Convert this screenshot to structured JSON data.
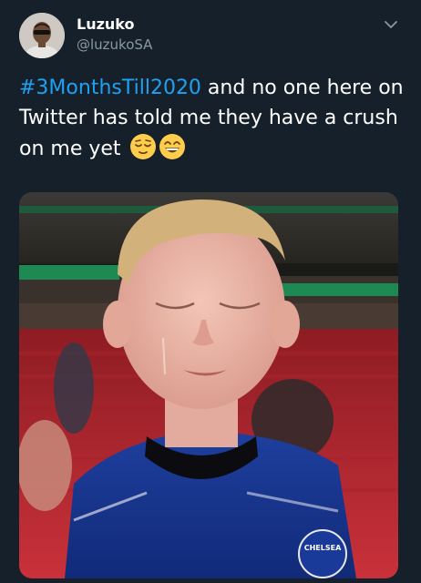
{
  "author": {
    "display_name": "Luzuko",
    "handle": "@luzukoSA"
  },
  "tweet": {
    "hashtag": "#3MonthsTill2020",
    "text_after_hashtag": " and no one here on Twitter has told me they have a crush on me yet",
    "emojis": [
      "relieved-face-emoji",
      "grinning-squinting-face-emoji"
    ]
  },
  "media": {
    "description_icon": "photo",
    "jersey_crest_text": "CHELSEA"
  },
  "colors": {
    "background": "#15202b",
    "text": "#ffffff",
    "secondary_text": "#8899a6",
    "link": "#1da1f2"
  }
}
